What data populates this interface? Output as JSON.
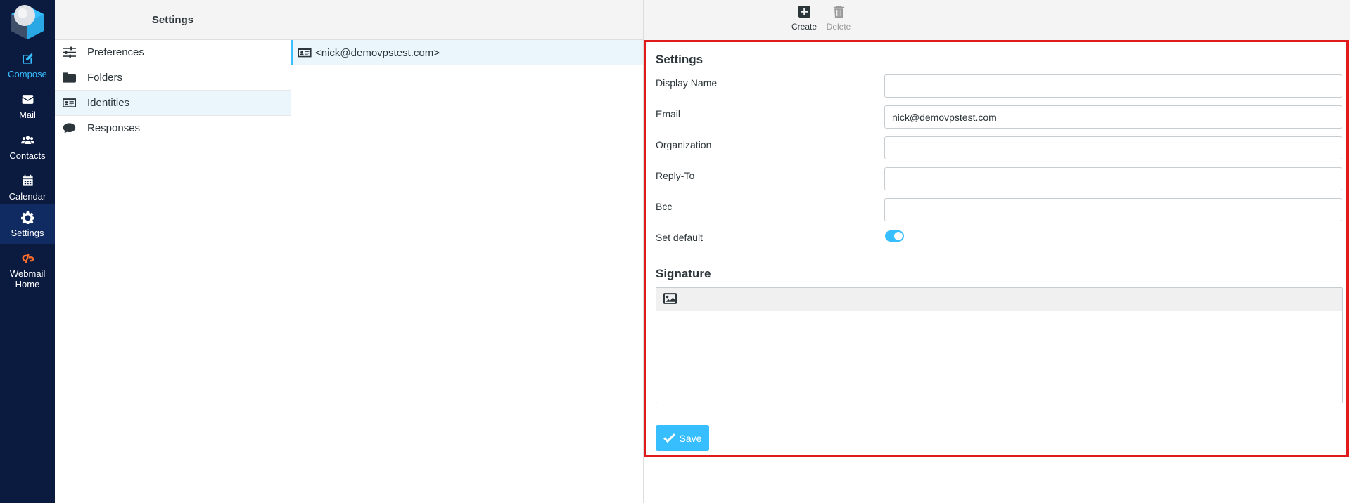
{
  "nav": {
    "items": [
      {
        "label": "Compose",
        "icon": "compose-icon"
      },
      {
        "label": "Mail",
        "icon": "envelope-icon"
      },
      {
        "label": "Contacts",
        "icon": "users-icon"
      },
      {
        "label": "Calendar",
        "icon": "calendar-icon"
      },
      {
        "label": "Settings",
        "icon": "gear-icon"
      },
      {
        "label": "Webmail Home",
        "icon": "cpanel-icon"
      }
    ]
  },
  "settings_column": {
    "title": "Settings",
    "items": [
      {
        "label": "Preferences",
        "icon": "sliders-icon"
      },
      {
        "label": "Folders",
        "icon": "folder-icon"
      },
      {
        "label": "Identities",
        "icon": "id-card-icon"
      },
      {
        "label": "Responses",
        "icon": "comment-icon"
      }
    ]
  },
  "identities_column": {
    "items": [
      {
        "label": "<nick@demovpstest.com>",
        "icon": "id-card-icon"
      }
    ]
  },
  "toolbar": {
    "create_label": "Create",
    "delete_label": "Delete"
  },
  "form": {
    "section_title": "Settings",
    "display_name_label": "Display Name",
    "display_name_value": "",
    "email_label": "Email",
    "email_value": "nick@demovpstest.com",
    "organization_label": "Organization",
    "organization_value": "",
    "reply_to_label": "Reply-To",
    "reply_to_value": "",
    "bcc_label": "Bcc",
    "bcc_value": "",
    "set_default_label": "Set default",
    "set_default_on": true,
    "signature_title": "Signature",
    "save_label": "Save"
  },
  "colors": {
    "nav_bg": "#0b1a3f",
    "accent": "#37beff",
    "highlight_frame": "#e11b1b",
    "selected_row": "#eaf6fc"
  }
}
